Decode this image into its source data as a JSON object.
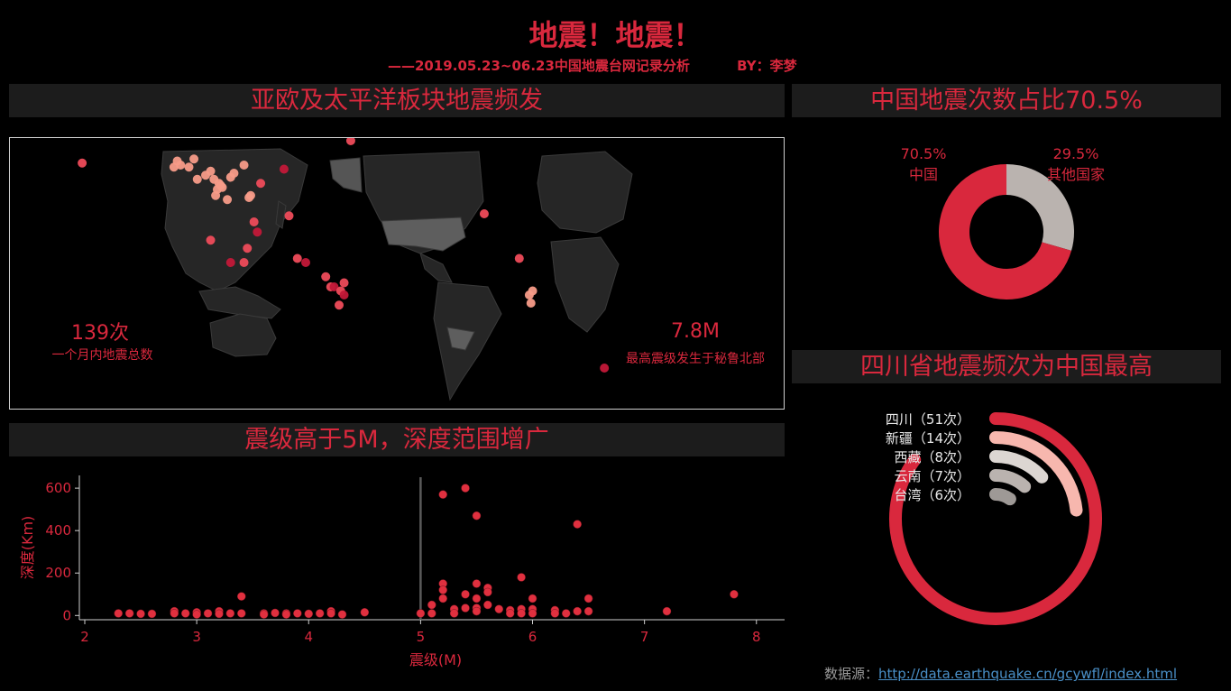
{
  "header": {
    "title": "地震！地震！",
    "subtitle": "——2019.05.23~06.23中国地震台网记录分析",
    "author": "BY：李梦"
  },
  "map_panel": {
    "heading": "亚欧及太平洋板块地震频发",
    "total_value": "139次",
    "total_label": "一个月内地震总数",
    "max_value": "7.8M",
    "max_label": "最高震级发生于秘鲁北部"
  },
  "scatter_panel": {
    "heading": "震级高于5M，深度范围增广"
  },
  "pie_panel": {
    "heading": "中国地震次数占比70.5%"
  },
  "radial_panel": {
    "heading": "四川省地震频次为中国最高"
  },
  "source": {
    "label": "数据源：",
    "url": "http://data.earthquake.cn/gcywfl/index.html"
  },
  "colors": {
    "accent": "#d9283d",
    "panel_bg": "#1c1c1c",
    "grey": "#bab3af"
  },
  "chart_data": [
    {
      "type": "map",
      "title": "亚欧及太平洋板块地震频发",
      "points": [
        {
          "lon": 112,
          "lat": 36
        },
        {
          "lon": 110,
          "lat": 34
        },
        {
          "lon": 104,
          "lat": 30
        },
        {
          "lon": 103,
          "lat": 31
        },
        {
          "lon": 105,
          "lat": 29
        },
        {
          "lon": 102,
          "lat": 28
        },
        {
          "lon": 100,
          "lat": 33
        },
        {
          "lon": 98,
          "lat": 37
        },
        {
          "lon": 95,
          "lat": 35
        },
        {
          "lon": 90,
          "lat": 33
        },
        {
          "lon": 85,
          "lat": 39
        },
        {
          "lon": 80,
          "lat": 40
        },
        {
          "lon": 78,
          "lat": 42
        },
        {
          "lon": 76,
          "lat": 39
        },
        {
          "lon": 88,
          "lat": 43
        },
        {
          "lon": 108,
          "lat": 23
        },
        {
          "lon": 101,
          "lat": 25
        },
        {
          "lon": 121,
          "lat": 24
        },
        {
          "lon": 122,
          "lat": 25
        },
        {
          "lon": 118,
          "lat": 40
        },
        {
          "lon": 124,
          "lat": 12
        },
        {
          "lon": 126,
          "lat": 7
        },
        {
          "lon": 120,
          "lat": -1
        },
        {
          "lon": 118,
          "lat": -8
        },
        {
          "lon": 110,
          "lat": -8
        },
        {
          "lon": 98,
          "lat": 3
        },
        {
          "lon": 128,
          "lat": 31
        },
        {
          "lon": 142,
          "lat": 38
        },
        {
          "lon": 145,
          "lat": 15
        },
        {
          "lon": 150,
          "lat": -6
        },
        {
          "lon": 155,
          "lat": -8
        },
        {
          "lon": 167,
          "lat": -15
        },
        {
          "lon": 170,
          "lat": -20
        },
        {
          "lon": 172,
          "lat": -20
        },
        {
          "lon": 178,
          "lat": -18
        },
        {
          "lon": 176,
          "lat": -22
        },
        {
          "lon": 178,
          "lat": -24
        },
        {
          "lon": 175,
          "lat": -29
        },
        {
          "lon": -178,
          "lat": 52
        },
        {
          "lon": -155,
          "lat": 61
        },
        {
          "lon": -98,
          "lat": 16
        },
        {
          "lon": -77,
          "lat": -6
        },
        {
          "lon": -71,
          "lat": -24
        },
        {
          "lon": -70,
          "lat": -28
        },
        {
          "lon": -69,
          "lat": -22
        },
        {
          "lon": -26,
          "lat": -60
        },
        {
          "lon": 21,
          "lat": 41
        }
      ]
    },
    {
      "type": "scatter",
      "title": "震级高于5M，深度范围增广",
      "xlabel": "震级(M)",
      "ylabel": "深度(Km)",
      "xlim": [
        2,
        8.3
      ],
      "ylim": [
        -20,
        660
      ],
      "xticks": [
        2,
        3,
        4,
        5,
        6,
        7,
        8
      ],
      "yticks": [
        0,
        200,
        400,
        600
      ],
      "reference_x": 5,
      "points": [
        {
          "x": 2.3,
          "y": 10
        },
        {
          "x": 2.4,
          "y": 10
        },
        {
          "x": 2.5,
          "y": 8
        },
        {
          "x": 2.6,
          "y": 8
        },
        {
          "x": 2.8,
          "y": 20
        },
        {
          "x": 2.8,
          "y": 10
        },
        {
          "x": 2.9,
          "y": 10
        },
        {
          "x": 3.0,
          "y": 15
        },
        {
          "x": 3.0,
          "y": 5
        },
        {
          "x": 3.1,
          "y": 10
        },
        {
          "x": 3.2,
          "y": 20
        },
        {
          "x": 3.2,
          "y": 8
        },
        {
          "x": 3.3,
          "y": 10
        },
        {
          "x": 3.4,
          "y": 90
        },
        {
          "x": 3.4,
          "y": 10
        },
        {
          "x": 3.6,
          "y": 10
        },
        {
          "x": 3.6,
          "y": 5
        },
        {
          "x": 3.7,
          "y": 12
        },
        {
          "x": 3.8,
          "y": 10
        },
        {
          "x": 3.8,
          "y": 5
        },
        {
          "x": 3.9,
          "y": 10
        },
        {
          "x": 4.0,
          "y": 8
        },
        {
          "x": 4.1,
          "y": 10
        },
        {
          "x": 4.2,
          "y": 20
        },
        {
          "x": 4.2,
          "y": 10
        },
        {
          "x": 4.3,
          "y": 5
        },
        {
          "x": 4.5,
          "y": 15
        },
        {
          "x": 5.0,
          "y": 10
        },
        {
          "x": 5.1,
          "y": 50
        },
        {
          "x": 5.1,
          "y": 10
        },
        {
          "x": 5.2,
          "y": 570
        },
        {
          "x": 5.2,
          "y": 150
        },
        {
          "x": 5.2,
          "y": 120
        },
        {
          "x": 5.2,
          "y": 80
        },
        {
          "x": 5.3,
          "y": 30
        },
        {
          "x": 5.3,
          "y": 10
        },
        {
          "x": 5.4,
          "y": 600
        },
        {
          "x": 5.4,
          "y": 100
        },
        {
          "x": 5.4,
          "y": 35
        },
        {
          "x": 5.5,
          "y": 470
        },
        {
          "x": 5.5,
          "y": 150
        },
        {
          "x": 5.5,
          "y": 80
        },
        {
          "x": 5.5,
          "y": 35
        },
        {
          "x": 5.5,
          "y": 20
        },
        {
          "x": 5.6,
          "y": 130
        },
        {
          "x": 5.6,
          "y": 110
        },
        {
          "x": 5.6,
          "y": 50
        },
        {
          "x": 5.7,
          "y": 30
        },
        {
          "x": 5.8,
          "y": 25
        },
        {
          "x": 5.8,
          "y": 10
        },
        {
          "x": 5.9,
          "y": 180
        },
        {
          "x": 5.9,
          "y": 30
        },
        {
          "x": 5.9,
          "y": 10
        },
        {
          "x": 6.0,
          "y": 80
        },
        {
          "x": 6.0,
          "y": 30
        },
        {
          "x": 6.0,
          "y": 10
        },
        {
          "x": 6.2,
          "y": 25
        },
        {
          "x": 6.2,
          "y": 10
        },
        {
          "x": 6.3,
          "y": 10
        },
        {
          "x": 6.4,
          "y": 430
        },
        {
          "x": 6.4,
          "y": 20
        },
        {
          "x": 6.5,
          "y": 80
        },
        {
          "x": 6.5,
          "y": 20
        },
        {
          "x": 7.2,
          "y": 20
        },
        {
          "x": 7.8,
          "y": 100
        }
      ]
    },
    {
      "type": "pie",
      "title": "中国地震次数占比70.5%",
      "slices": [
        {
          "name": "中国",
          "value": 70.5,
          "label": "70.5%",
          "color": "#d9283d"
        },
        {
          "name": "其他国家",
          "value": 29.5,
          "label": "29.5%",
          "color": "#bab3af"
        }
      ]
    },
    {
      "type": "bar",
      "title": "四川省地震频次为中国最高",
      "categories": [
        "四川",
        "新疆",
        "西藏",
        "云南",
        "台湾"
      ],
      "values": [
        51,
        14,
        8,
        7,
        6
      ],
      "labels": [
        "四川（51次）",
        "新疆（14次）",
        "西藏（8次）",
        "云南（7次）",
        "台湾（6次）"
      ],
      "colors": [
        "#d9283d",
        "#f7b7ae",
        "#dcd6d2",
        "#bab3af",
        "#9e9996"
      ]
    }
  ]
}
